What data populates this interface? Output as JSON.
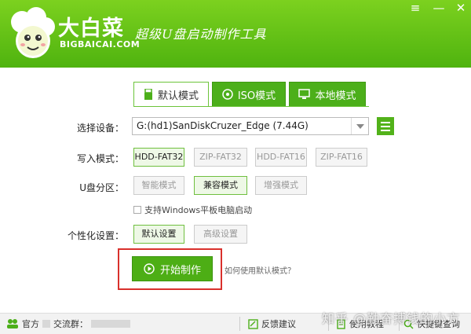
{
  "header": {
    "brand": "大白菜",
    "brand_sub": "BIGBAICAI.COM",
    "slogan": "超级U盘启动制作工具",
    "menu_icon": "≡",
    "min_icon": "—",
    "close_icon": "✕"
  },
  "tabs": [
    {
      "label": "默认模式",
      "icon": "usb-icon",
      "active": true
    },
    {
      "label": "ISO模式",
      "icon": "disc-icon",
      "active": false
    },
    {
      "label": "本地模式",
      "icon": "monitor-icon",
      "active": false
    }
  ],
  "form": {
    "device_label": "选择设备：",
    "device_value": "G:(hd1)SanDiskCruzer_Edge (7.44G)",
    "write_label": "写入模式：",
    "write_options": [
      "HDD-FAT32",
      "ZIP-FAT32",
      "HDD-FAT16",
      "ZIP-FAT16"
    ],
    "write_selected": 0,
    "partition_label": "U盘分区：",
    "partition_options": [
      "智能模式",
      "兼容模式",
      "增强模式"
    ],
    "partition_selected": 1,
    "tablet_checkbox": "支持Windows平板电脑启动",
    "personal_label": "个性化设置：",
    "personal_options": [
      "默认设置",
      "高级设置"
    ],
    "personal_selected": 0,
    "start_button": "开始制作",
    "howto_link": "如何使用默认模式？"
  },
  "footer": {
    "group_label": "官方",
    "group_label2": "交流群：",
    "feedback": "反馈建议",
    "tutorial": "使用教程",
    "quick_lookup": "快捷键查询"
  },
  "watermark": "知乎 @勤奋搏钱的小方",
  "colors": {
    "brand_green": "#4fb30f",
    "highlight_red": "#d9302c"
  }
}
